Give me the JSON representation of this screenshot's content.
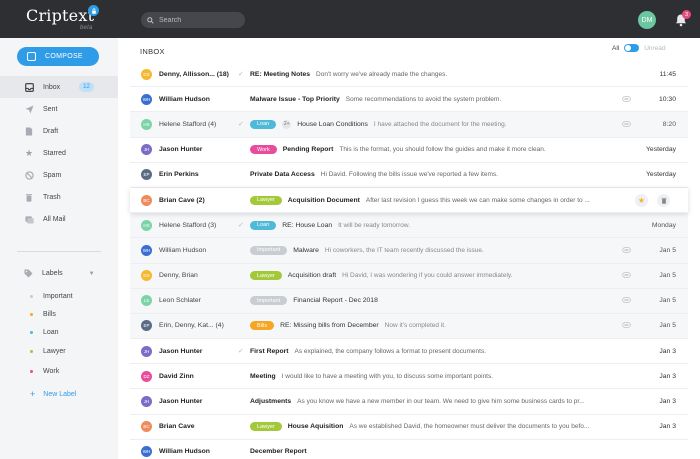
{
  "app": {
    "logo": "Criptext",
    "beta": "beta"
  },
  "search": {
    "placeholder": "Search"
  },
  "user": {
    "initials": "DM",
    "avatar_color": "#6cc6a0"
  },
  "notifications": {
    "count": "3"
  },
  "sidebar": {
    "compose_label": "COMPOSE",
    "items": [
      {
        "label": "Inbox",
        "icon": "inbox-icon",
        "badge": "12"
      },
      {
        "label": "Sent",
        "icon": "send-icon"
      },
      {
        "label": "Draft",
        "icon": "draft-icon"
      },
      {
        "label": "Starred",
        "icon": "star-icon"
      },
      {
        "label": "Spam",
        "icon": "spam-icon"
      },
      {
        "label": "Trash",
        "icon": "trash-icon"
      },
      {
        "label": "All Mail",
        "icon": "all-mail-icon"
      }
    ],
    "labels_title": "Labels",
    "labels": [
      {
        "label": "Important",
        "color": "#c9ccd1"
      },
      {
        "label": "Bills",
        "color": "#f5a623"
      },
      {
        "label": "Loan",
        "color": "#4fb9d8"
      },
      {
        "label": "Lawyer",
        "color": "#a3c93a"
      },
      {
        "label": "Work",
        "color": "#e84c9c"
      }
    ],
    "new_label": "New Label"
  },
  "main": {
    "title": "INBOX",
    "filter_all": "All",
    "filter_unread": "Unread",
    "emails": [
      {
        "initials": "DS",
        "avatar": "#f5b82e",
        "sender": "Denny, Allisson... (18)",
        "label": "",
        "label_color": "",
        "count": "",
        "subject": "RE: Meeting Notes",
        "preview": "Don't worry we've already made the changes.",
        "date": "11:45",
        "read": false,
        "replied": true,
        "attachment": false
      },
      {
        "initials": "WH",
        "avatar": "#3a6ed1",
        "sender": "William Hudson",
        "label": "",
        "label_color": "",
        "count": "",
        "subject": "Malware Issue - Top Priority",
        "preview": "Some recommendations to avoid the system problem.",
        "date": "10:30",
        "read": false,
        "replied": false,
        "attachment": true
      },
      {
        "initials": "HS",
        "avatar": "#7dd3a8",
        "sender": "Helene Stafford (4)",
        "label": "Loan",
        "label_color": "#4fb9d8",
        "count": "2+",
        "subject": "House Loan Conditions",
        "preview": "I have attached the document for the meeting.",
        "date": "8:20",
        "read": true,
        "replied": true,
        "attachment": true
      },
      {
        "initials": "JH",
        "avatar": "#7b6cc7",
        "sender": "Jason Hunter",
        "label": "Work",
        "label_color": "#e84c9c",
        "count": "",
        "subject": "Pending Report",
        "preview": "This is the format, you should follow the guides and make it more clean.",
        "date": "Yesterday",
        "read": false,
        "replied": false,
        "attachment": false
      },
      {
        "initials": "EP",
        "avatar": "#5a6b85",
        "sender": "Erin Perkins",
        "label": "",
        "label_color": "",
        "count": "",
        "subject": "Private Data Access",
        "preview": "Hi David. Following the bills issue we've reported a few items.",
        "date": "Yesterday",
        "read": false,
        "replied": false,
        "attachment": false
      },
      {
        "initials": "BC",
        "avatar": "#ef8a5a",
        "sender": "Brian Cave (2)",
        "label": "Lawyer",
        "label_color": "#a3c93a",
        "count": "",
        "subject": "Acquisition Document",
        "preview": "After last revision I guess this week we can make some changes in order to ...",
        "date": "",
        "read": false,
        "replied": false,
        "attachment": false,
        "hover": true
      },
      {
        "initials": "HS",
        "avatar": "#7dd3a8",
        "sender": "Helene Stafford (3)",
        "label": "Loan",
        "label_color": "#4fb9d8",
        "count": "",
        "subject": "RE: House Loan",
        "preview": "It will be ready tomorrow.",
        "date": "Monday",
        "read": true,
        "replied": true,
        "attachment": false
      },
      {
        "initials": "WH",
        "avatar": "#3a6ed1",
        "sender": "William Hudson",
        "label": "Important",
        "label_color": "#c9ccd1",
        "count": "",
        "subject": "Malware",
        "preview": "Hi coworkers, the IT team recently discussed the issue.",
        "date": "Jan 5",
        "read": true,
        "replied": false,
        "attachment": true
      },
      {
        "initials": "DS",
        "avatar": "#f5b82e",
        "sender": "Denny, Brian",
        "label": "Lawyer",
        "label_color": "#a3c93a",
        "count": "",
        "subject": "Acquisition draft",
        "preview": "Hi David, I was wondering if you could answer immediately.",
        "date": "Jan 5",
        "read": true,
        "replied": false,
        "attachment": true
      },
      {
        "initials": "LS",
        "avatar": "#7dd3a8",
        "sender": "Leon Schlater",
        "label": "Important",
        "label_color": "#c9ccd1",
        "count": "",
        "subject": "Financial Report - Dec 2018",
        "preview": "",
        "date": "Jan 5",
        "read": true,
        "replied": false,
        "attachment": true
      },
      {
        "initials": "EP",
        "avatar": "#5a6b85",
        "sender": "Erin, Denny, Kat... (4)",
        "label": "Bills",
        "label_color": "#f5a623",
        "count": "",
        "subject": "RE: Missing bills from December",
        "preview": "Now it's completed it.",
        "date": "Jan 5",
        "read": true,
        "replied": false,
        "attachment": true
      },
      {
        "initials": "JH",
        "avatar": "#7b6cc7",
        "sender": "Jason Hunter",
        "label": "",
        "label_color": "",
        "count": "",
        "subject": "First Report",
        "preview": "As explained, the company follows a format to present documents.",
        "date": "Jan 3",
        "read": false,
        "replied": true,
        "attachment": false
      },
      {
        "initials": "DZ",
        "avatar": "#e84c9c",
        "sender": "David Zinn",
        "label": "",
        "label_color": "",
        "count": "",
        "subject": "Meeting",
        "preview": "I would like to have a meeting with you, to discuss some important points.",
        "date": "Jan 3",
        "read": false,
        "replied": false,
        "attachment": false
      },
      {
        "initials": "JH",
        "avatar": "#7b6cc7",
        "sender": "Jason Hunter",
        "label": "",
        "label_color": "",
        "count": "",
        "subject": "Adjustments",
        "preview": "As you know we have a new member in our team. We need to give him some business cards to pr...",
        "date": "Jan 3",
        "read": false,
        "replied": false,
        "attachment": false
      },
      {
        "initials": "BC",
        "avatar": "#ef8a5a",
        "sender": "Brian Cave",
        "label": "Lawyer",
        "label_color": "#a3c93a",
        "count": "",
        "subject": "House Aquisition",
        "preview": "As we established David, the homeowner must deliver the documents to you befo...",
        "date": "Jan 3",
        "read": false,
        "replied": false,
        "attachment": false
      },
      {
        "initials": "WH",
        "avatar": "#3a6ed1",
        "sender": "William Hudson",
        "label": "",
        "label_color": "",
        "count": "",
        "subject": "December Report",
        "preview": "",
        "date": "",
        "read": false,
        "replied": false,
        "attachment": false
      }
    ]
  }
}
